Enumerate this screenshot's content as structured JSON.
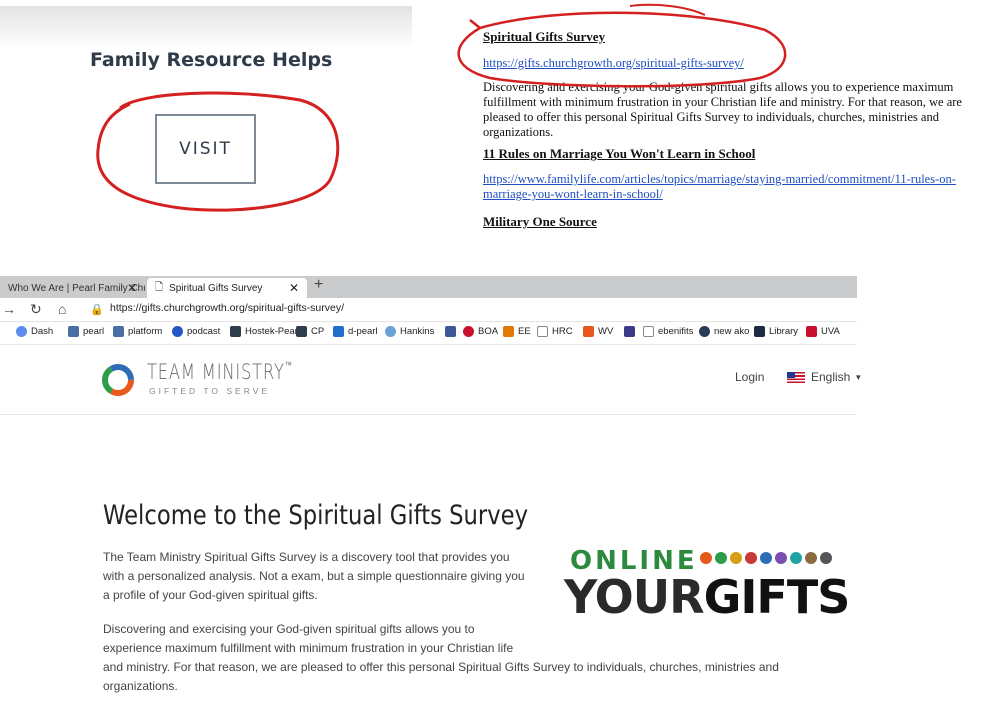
{
  "family_resource": {
    "title": "Family Resource Helps",
    "visit_label": "VISIT"
  },
  "document": {
    "section1_heading": "Spiritual Gifts Survey",
    "section1_link": "https://gifts.churchgrowth.org/spiritual-gifts-survey/",
    "section1_text": "Discovering and exercising your God-given spiritual gifts allows you to experience maximum fulfillment with minimum frustration in your Christian life and ministry. For that reason, we are pleased to offer this personal Spiritual Gifts Survey to individuals, churches, ministries and organizations.",
    "section2_heading": "11 Rules on Marriage You Won't Learn in School",
    "section2_link": "https://www.familylife.com/articles/topics/marriage/staying-married/commitment/11-rules-on-marriage-you-wont-learn-in-school/",
    "section3_heading": "Military One Source"
  },
  "browser": {
    "tabs": [
      {
        "label": "Who We Are | Pearl Family Churc"
      },
      {
        "label": "Spiritual Gifts Survey"
      }
    ],
    "url": "https://gifts.churchgrowth.org/spiritual-gifts-survey/",
    "favorites": [
      "Dash",
      "pearl",
      "platform",
      "podcast",
      "Hostek-Pearl",
      "CP",
      "d-pearl",
      "Hankins",
      "BOA",
      "EE",
      "HRC",
      "WV",
      "ebenifits",
      "new ako",
      "Library",
      "UVA"
    ]
  },
  "site": {
    "logo_name": "TEAM MINISTRY",
    "logo_trademark": "™",
    "logo_tagline": "GIFTED TO SERVE",
    "login": "Login",
    "language": "English",
    "welcome_title": "Welcome to the Spiritual Gifts Survey",
    "intro_lines": [
      "The Team Ministry Spiritual Gifts Survey is a discovery tool that provides you",
      "with a personalized analysis. Not a exam, but a simple questionnaire giving you",
      "a profile of your God-given spiritual gifts."
    ],
    "body_lines": [
      "Discovering and exercising your God-given spiritual gifts allows you to",
      "experience maximum fulfillment with minimum frustration in your Christian life",
      "and ministry. For that reason, we are pleased to offer this personal Spiritual Gifts Survey to individuals, churches, ministries and",
      "organizations."
    ],
    "badge_top": "ONLINE",
    "badge_your": "YOUR",
    "badge_gifts": "GIFTS"
  },
  "colors": {
    "annotation": "#d42020",
    "link": "#1f4fc0",
    "badge_green": "#2b8a3e"
  }
}
